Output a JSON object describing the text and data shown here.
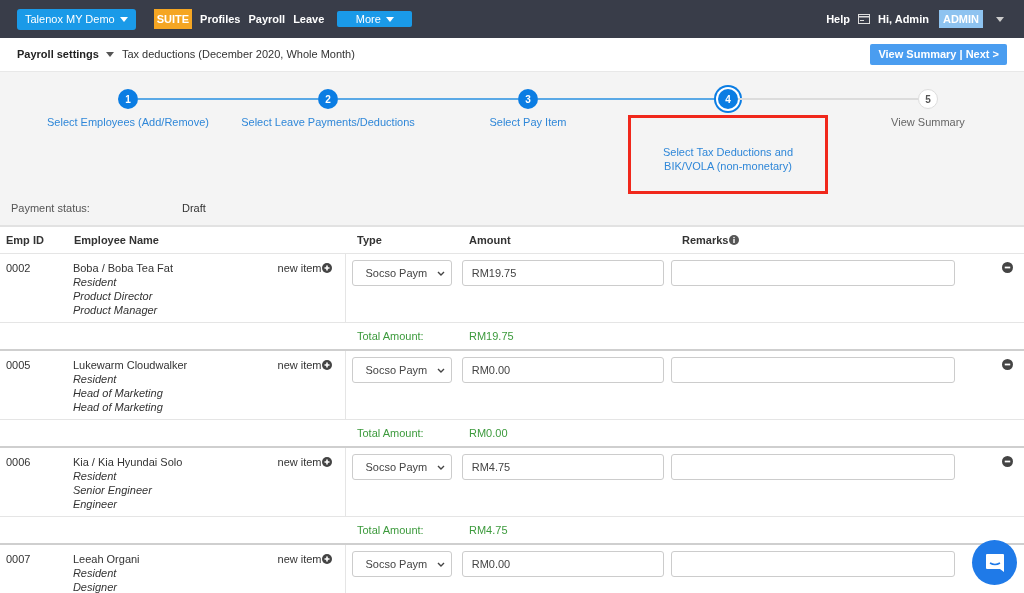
{
  "topbar": {
    "company": "Talenox MY Demo",
    "suite_badge": "SUITE",
    "links": [
      "Profiles",
      "Payroll",
      "Leave"
    ],
    "more": "More",
    "help": "Help",
    "greeting": "Hi, Admin",
    "role_badge": "ADMIN"
  },
  "subheader": {
    "section": "Payroll settings",
    "title": "Tax deductions (December 2020, Whole Month)",
    "next_button": "View Summary | Next >"
  },
  "steps": [
    {
      "number": "1",
      "label": "Select Employees (Add/Remove)",
      "completed": true,
      "selected": false,
      "highlighted": false
    },
    {
      "number": "2",
      "label": "Select Leave Payments/Deductions",
      "completed": true,
      "selected": false,
      "highlighted": false
    },
    {
      "number": "3",
      "label": "Select Pay Item",
      "completed": true,
      "selected": false,
      "highlighted": false
    },
    {
      "number": "4",
      "label": "Select Tax Deductions and BIK/VOLA (non-monetary)",
      "completed": false,
      "selected": true,
      "highlighted": true
    },
    {
      "number": "5",
      "label": "View Summary",
      "completed": false,
      "selected": false,
      "highlighted": false
    }
  ],
  "payment_status": {
    "label": "Payment status:",
    "value": "Draft"
  },
  "table": {
    "columns": [
      "Emp ID",
      "Employee Name",
      "Type",
      "Amount",
      "Remarks"
    ],
    "rows": [
      {
        "emp_id": "0002",
        "name": "Boba / Boba Tea Fat",
        "details": [
          "Resident",
          "Product Director",
          "Product Manager"
        ],
        "new_item": "new item",
        "type": "Socso Paym",
        "amount": "RM19.75",
        "removable": true,
        "total_label": "Total Amount:",
        "total": "RM19.75"
      },
      {
        "emp_id": "0005",
        "name": "Lukewarm Cloudwalker",
        "details": [
          "Resident",
          "Head of Marketing",
          "Head of Marketing"
        ],
        "new_item": "new item",
        "type": "Socso Paym",
        "amount": "RM0.00",
        "removable": true,
        "total_label": "Total Amount:",
        "total": "RM0.00"
      },
      {
        "emp_id": "0006",
        "name": "Kia / Kia Hyundai Solo",
        "details": [
          "Resident",
          "Senior Engineer",
          "Engineer"
        ],
        "new_item": "new item",
        "type": "Socso Paym",
        "amount": "RM4.75",
        "removable": true,
        "total_label": "Total Amount:",
        "total": "RM4.75"
      },
      {
        "emp_id": "0007",
        "name": "Leeah Organi",
        "details": [
          "Resident",
          "Designer"
        ],
        "new_item": "new item",
        "type": "Socso Paym",
        "amount": "RM0.00"
      }
    ]
  }
}
